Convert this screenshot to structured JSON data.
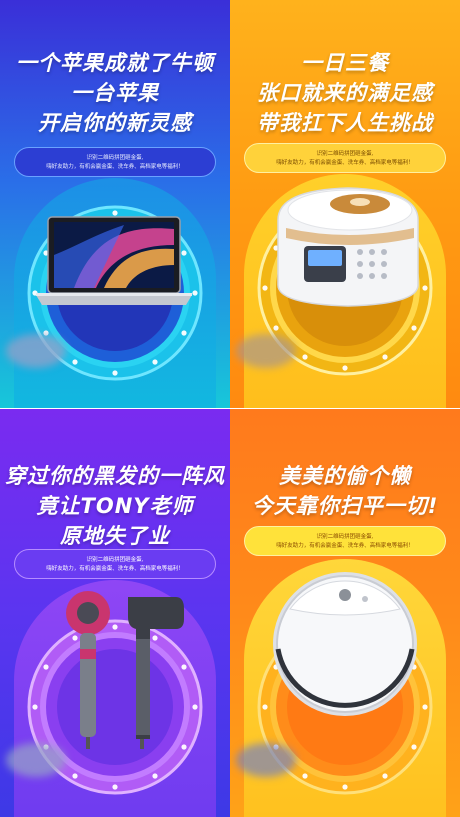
{
  "posters": [
    {
      "headline": [
        "一个苹果成就了牛顿",
        "一台苹果",
        "开启你的新灵感"
      ],
      "pill": [
        "识别二维码拼团砸金蛋,",
        "嗨好友助力，有机会赢金蛋、洗车券、高档家电等福利！"
      ]
    },
    {
      "headline": [
        "一日三餐",
        "张口就来的满足感",
        "带我扛下人生挑战"
      ],
      "pill": [
        "识别二维码拼团砸金蛋,",
        "嗨好友助力，有机会赢金蛋、洗车券、高档家电等福利！"
      ]
    },
    {
      "headline": [
        "穿过你的黑发的一阵风",
        "竟让TONY老师",
        "原地失了业"
      ],
      "pill": [
        "识别二维码拼团砸金蛋,",
        "嗨好友助力，有机会赢金蛋、洗车券、高档家电等福利！"
      ]
    },
    {
      "headline": [
        "美美的偷个懒",
        "今天靠你扫平一切!"
      ],
      "pill": [
        "识别二维码拼团砸金蛋,",
        "嗨好友助力，有机会赢金蛋、洗车券、高档家电等福利！"
      ]
    }
  ],
  "colors": {
    "poster1": "#2a6fe8",
    "poster2": "#ff9b12",
    "poster3": "#5b35f0",
    "poster4": "#ff8a1a"
  },
  "icons": [
    "laptop-icon",
    "rice-cooker-icon",
    "hair-dryer-icon",
    "robot-vacuum-icon"
  ]
}
